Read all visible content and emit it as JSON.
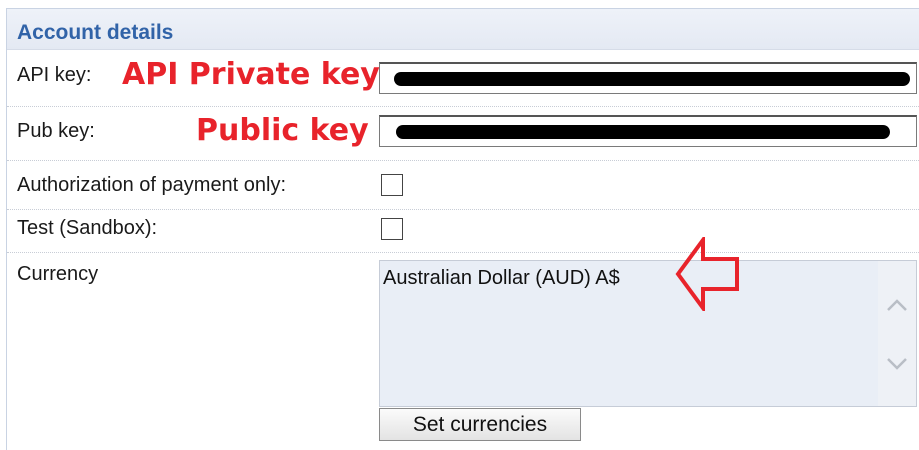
{
  "section": {
    "title": "Account details"
  },
  "rows": {
    "api_key": {
      "label": "API key:",
      "annotation": "API Private key"
    },
    "pub_key": {
      "label": "Pub key:",
      "annotation": "Public key"
    },
    "auth_only": {
      "label": "Authorization of payment only:",
      "checked": false
    },
    "test": {
      "label": "Test (Sandbox):",
      "checked": false
    },
    "currency": {
      "label": "Currency",
      "selected": "Australian Dollar (AUD) A$"
    }
  },
  "buttons": {
    "set_currencies": "Set currencies"
  },
  "colors": {
    "annotation": "#e8232b",
    "title": "#3163a8",
    "listbox_bg": "#e9eef6"
  },
  "icons": [
    "chevron-up-icon",
    "chevron-down-icon",
    "arrow-left-annotation-icon"
  ]
}
